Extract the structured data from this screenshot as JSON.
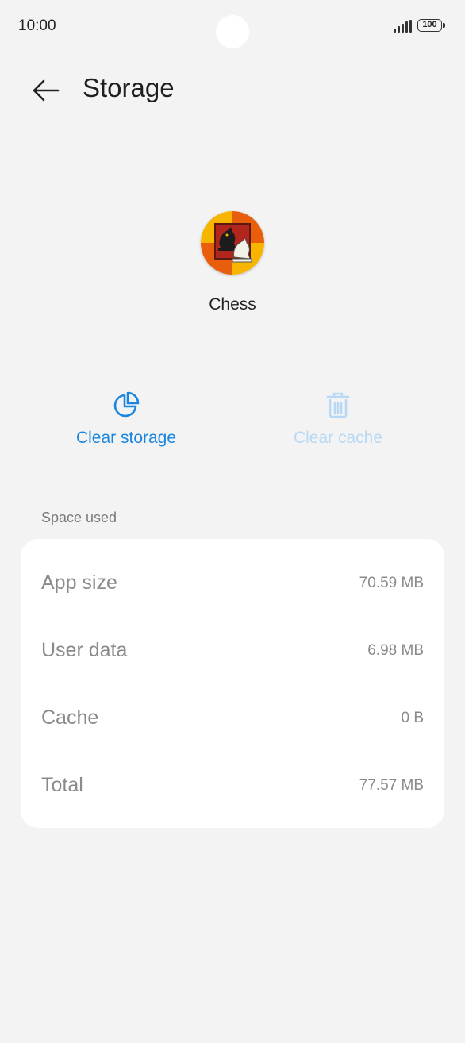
{
  "status_bar": {
    "time": "10:00",
    "battery_level": "100"
  },
  "header": {
    "title": "Storage",
    "back_icon": "arrow-left-icon"
  },
  "app": {
    "name": "Chess",
    "icon": "chess-knight-app-icon"
  },
  "actions": {
    "clear_storage": {
      "label": "Clear storage",
      "icon": "pie-chart-icon",
      "color": "#1a86e0",
      "enabled": true
    },
    "clear_cache": {
      "label": "Clear cache",
      "icon": "trash-icon",
      "color": "#b7d9f5",
      "enabled": false
    }
  },
  "space_used": {
    "header": "Space used",
    "rows": [
      {
        "label": "App size",
        "value": "70.59 MB"
      },
      {
        "label": "User data",
        "value": "6.98 MB"
      },
      {
        "label": "Cache",
        "value": "0 B"
      },
      {
        "label": "Total",
        "value": "77.57 MB"
      }
    ]
  }
}
